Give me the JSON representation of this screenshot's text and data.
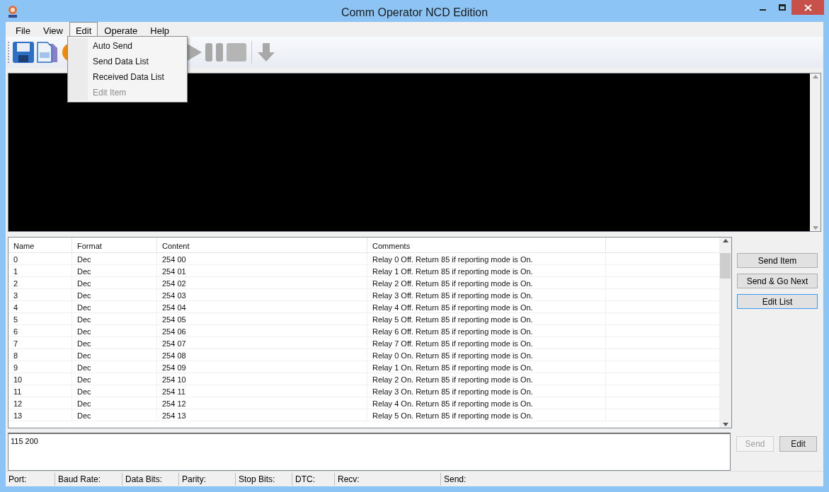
{
  "window": {
    "title": "Comm Operator NCD Edition"
  },
  "menu": [
    {
      "label": "File",
      "selected": false
    },
    {
      "label": "View",
      "selected": false
    },
    {
      "label": "Edit",
      "selected": true
    },
    {
      "label": "Operate",
      "selected": false
    },
    {
      "label": "Help",
      "selected": false
    }
  ],
  "dropdown": [
    {
      "label": "Auto Send",
      "disabled": false
    },
    {
      "label": "Send Data List",
      "disabled": false
    },
    {
      "label": "Received Data List",
      "disabled": false
    },
    {
      "label": "Edit Item",
      "disabled": true
    }
  ],
  "toolbar": [
    {
      "kind": "save"
    },
    {
      "kind": "copy"
    },
    {
      "kind": "connect"
    },
    {
      "kind": "play"
    },
    {
      "kind": "pause"
    },
    {
      "kind": "stop"
    },
    {
      "kind": "separator"
    },
    {
      "kind": "down"
    }
  ],
  "table": {
    "columns": [
      "Name",
      "Format",
      "Content",
      "Comments"
    ],
    "rows": [
      [
        "0",
        "Dec",
        "254 00",
        "Relay 0 Off. Return 85 if reporting mode is On."
      ],
      [
        "1",
        "Dec",
        "254 01",
        "Relay 1 Off. Return 85 if reporting mode is On."
      ],
      [
        "2",
        "Dec",
        "254 02",
        "Relay 2 Off. Return 85 if reporting mode is On."
      ],
      [
        "3",
        "Dec",
        "254 03",
        "Relay 3 Off. Return 85 if reporting mode is On."
      ],
      [
        "4",
        "Dec",
        "254 04",
        "Relay 4 Off. Return 85 if reporting mode is On."
      ],
      [
        "5",
        "Dec",
        "254 05",
        "Relay 5 Off. Return 85 if reporting mode is On."
      ],
      [
        "6",
        "Dec",
        "254 06",
        "Relay 6 Off. Return 85 if reporting mode is On."
      ],
      [
        "7",
        "Dec",
        "254 07",
        "Relay 7 Off. Return 85 if reporting mode is On."
      ],
      [
        "8",
        "Dec",
        "254 08",
        "Relay 0 On. Return 85 if reporting mode is On."
      ],
      [
        "9",
        "Dec",
        "254 09",
        "Relay 1 On. Return 85 if reporting mode is On."
      ],
      [
        "10",
        "Dec",
        "254 10",
        "Relay 2 On. Return 85 if reporting mode is On."
      ],
      [
        "11",
        "Dec",
        "254 11",
        "Relay 3 On. Return 85 if reporting mode is On."
      ],
      [
        "12",
        "Dec",
        "254 12",
        "Relay 4 On. Return 85 if reporting mode is On."
      ],
      [
        "13",
        "Dec",
        "254 13",
        "Relay 5 On. Return 85 if reporting mode is On."
      ]
    ]
  },
  "side_buttons": [
    {
      "label": "Send Item",
      "focused": false
    },
    {
      "label": "Send & Go Next",
      "focused": false
    },
    {
      "label": "Edit List",
      "focused": true
    }
  ],
  "input": {
    "value": "115 200"
  },
  "bottom_buttons": [
    {
      "label": "Send",
      "disabled": true
    },
    {
      "label": "Edit",
      "disabled": false
    }
  ],
  "status_bar": [
    "Port:",
    "Baud Rate:",
    "Data Bits:",
    "Parity:",
    "Stop Bits:",
    "DTC:",
    "Recv:",
    "Send:"
  ]
}
